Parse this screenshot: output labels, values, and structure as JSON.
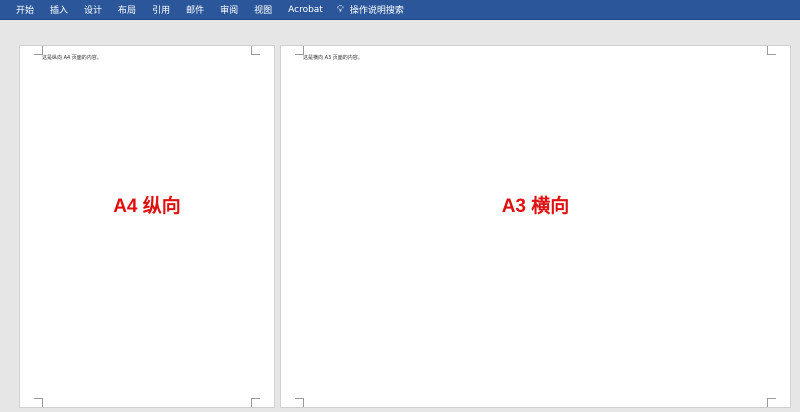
{
  "ribbon": {
    "tabs": [
      "开始",
      "插入",
      "设计",
      "布局",
      "引用",
      "邮件",
      "审阅",
      "视图",
      "Acrobat"
    ],
    "search_label": "操作说明搜索"
  },
  "pages": [
    {
      "body_text": "这是纵向 A4 页面的内容。",
      "label": "A4 纵向"
    },
    {
      "body_text": "这是横向 A3 页面的内容。",
      "label": "A3 横向"
    }
  ]
}
